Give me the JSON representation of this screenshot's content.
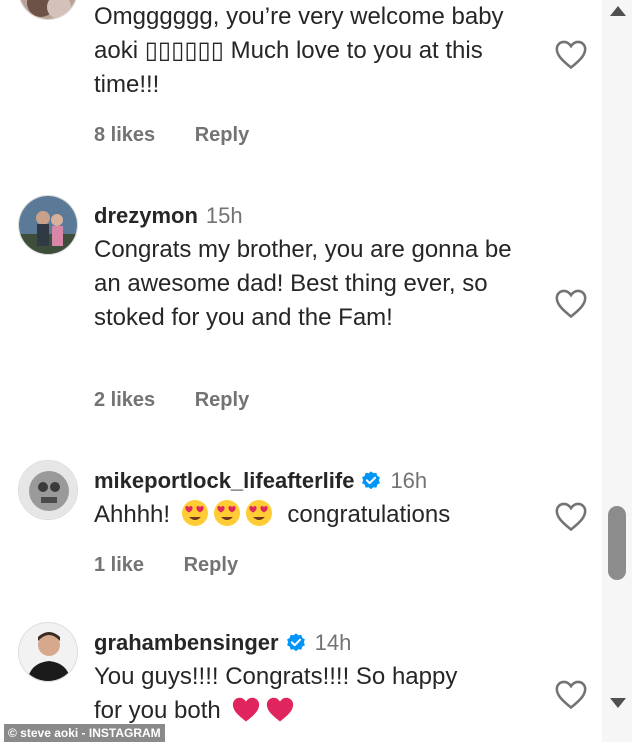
{
  "comments": [
    {
      "username": "",
      "time": "",
      "text": "Omgggggg, you’re very welcome baby aoki ▯▯▯▯▯▯ Much love to you at this time!!!",
      "likes": "8 likes",
      "reply": "Reply",
      "verified": false
    },
    {
      "username": "drezymon",
      "time": "15h",
      "text": "Congrats my brother, you are gonna be an awesome dad! Best thing ever, so stoked for you and the Fam!",
      "likes": "2 likes",
      "reply": "Reply",
      "verified": false
    },
    {
      "username": "mikeportlock_lifeafterlife",
      "time": "16h",
      "text_prefix": "Ahhhh!",
      "text_suffix": "congratulations",
      "emoji": [
        "heart-eyes-emoji",
        "heart-eyes-emoji",
        "heart-eyes-emoji"
      ],
      "likes": "1 like",
      "reply": "Reply",
      "verified": true
    },
    {
      "username": "grahambensinger",
      "time": "14h",
      "text_line1": "You guys!!!! Congrats!!!! So happy",
      "text_line2": "for you both",
      "emoji": [
        "red-heart-emoji",
        "red-heart-emoji"
      ],
      "verified": true
    }
  ],
  "credit": "© steve aoki - INSTAGRAM",
  "colors": {
    "text": "#262626",
    "muted": "#737373",
    "verified": "#0095f6",
    "heart": "#e0245e"
  },
  "icons": [
    "heart-outline-icon",
    "verified-badge-icon",
    "scroll-up-arrow-icon",
    "scroll-down-arrow-icon"
  ]
}
